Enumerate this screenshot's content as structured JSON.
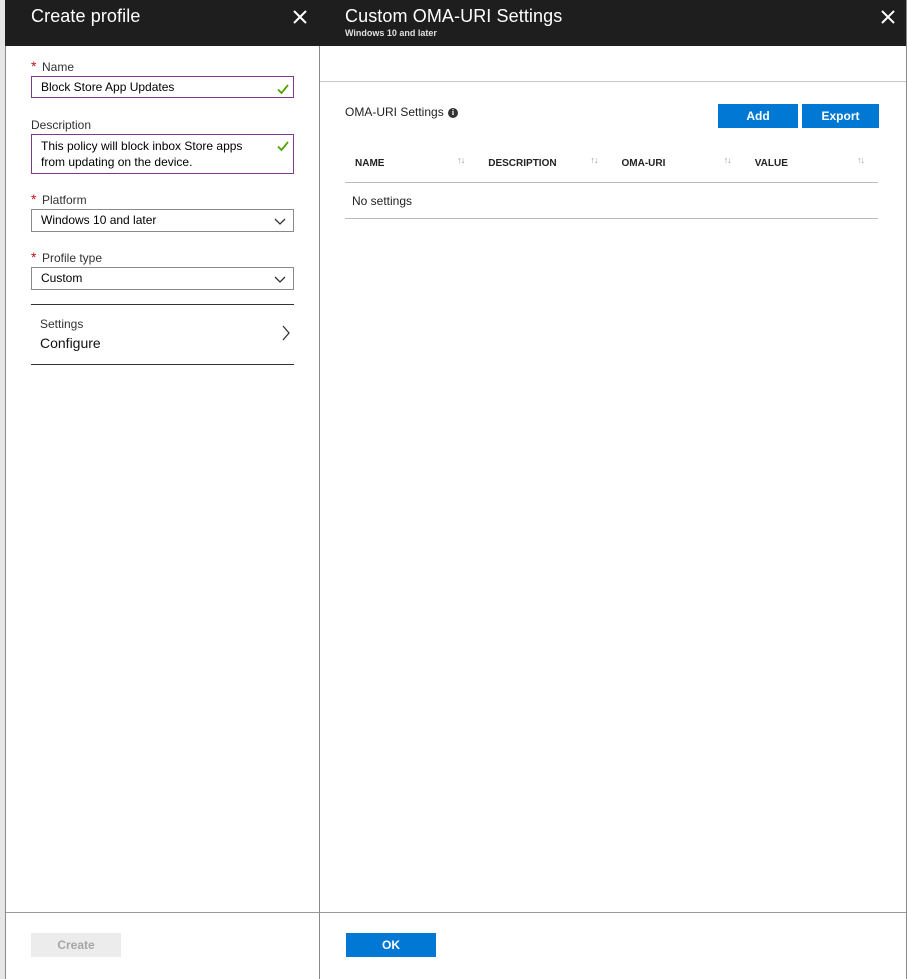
{
  "left_blade": {
    "title": "Create profile",
    "name_label": "Name",
    "name_value": "Block Store App Updates",
    "description_label": "Description",
    "description_line1": "This policy will block inbox Store apps",
    "description_line2": "from updating on the device.",
    "platform_label": "Platform",
    "platform_value": "Windows 10 and later",
    "profile_type_label": "Profile type",
    "profile_type_value": "Custom",
    "settings_label": "Settings",
    "settings_value": "Configure",
    "create_button": "Create",
    "required_mark": "*"
  },
  "right_blade": {
    "title": "Custom OMA-URI Settings",
    "subtitle": "Windows 10 and later",
    "section_title": "OMA-URI Settings",
    "info_glyph": "i",
    "add_button": "Add",
    "export_button": "Export",
    "columns": [
      "NAME",
      "DESCRIPTION",
      "OMA-URI",
      "VALUE"
    ],
    "sort_glyph": "↑↓",
    "empty_text": "No settings",
    "ok_button": "OK"
  },
  "colors": {
    "header_bg": "#1e1e1e",
    "accent": "#0078d4",
    "valid_border": "#7d3b8c",
    "check": "#57a300",
    "required": "#c50f1f"
  },
  "icons": [
    "close-icon",
    "checkmark-icon",
    "chevron-down-icon",
    "chevron-right-icon",
    "info-icon",
    "sort-icon"
  ]
}
